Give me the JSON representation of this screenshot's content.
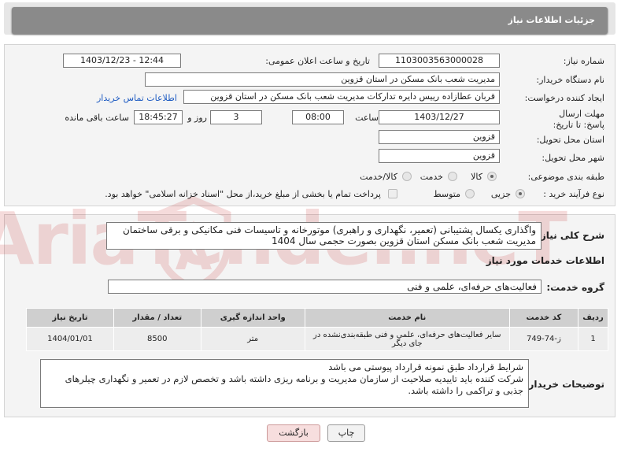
{
  "header": {
    "title": "جزئیات اطلاعات نیاز"
  },
  "form": {
    "need_number_label": "شماره نیاز:",
    "need_number": "1103003563000028",
    "announce_label": "تاریخ و ساعت اعلان عمومی:",
    "announce_value": "1403/12/23 - 12:44",
    "buyer_label": "نام دستگاه خریدار:",
    "buyer_value": "مدیریت شعب بانک مسکن در استان قزوین",
    "creator_label": "ایجاد کننده درخواست:",
    "creator_value": "قربان عطازاده رییس دایره تدارکات مدیریت شعب بانک مسکن در استان قزوین",
    "contact_link": "اطلاعات تماس خریدار",
    "deadline_label": "مهلت ارسال پاسخ: تا تاریخ:",
    "deadline_date": "1403/12/27",
    "time_label": "ساعت",
    "deadline_time": "08:00",
    "days_value": "3",
    "days_label": "روز و",
    "remaining_time": "18:45:27",
    "remaining_label": "ساعت باقی مانده",
    "province_label": "استان محل تحویل:",
    "province_value": "قزوین",
    "city_label": "شهر محل تحویل:",
    "city_value": "قزوین",
    "category_label": "طبقه بندی موضوعی:",
    "category_options": [
      "کالا",
      "خدمت",
      "کالا/خدمت"
    ],
    "process_label": "نوع فرآیند خرید :",
    "process_options": [
      "جزیی",
      "متوسط"
    ],
    "payment_note": "پرداخت تمام یا بخشی از مبلغ خرید،از محل \"اسناد خزانه اسلامی\" خواهد بود."
  },
  "summary": {
    "label": "شرح کلی نیاز:",
    "text": "واگذاری یکسال پشتیبانی (تعمیر، نگهداری و راهبری) موتورخانه و تاسیسات فنی مکانیکی و برقی ساختمان مدیریت شعب بانک مسکن استان قزوین بصورت حجمی سال 1404"
  },
  "services": {
    "title": "اطلاعات خدمات مورد نیاز",
    "group_label": "گروه خدمت:",
    "group_value": "فعالیت‌های حرفه‌ای، علمی و فنی",
    "columns": [
      "ردیف",
      "کد خدمت",
      "نام خدمت",
      "واحد اندازه گیری",
      "تعداد / مقدار",
      "تاریخ نیاز"
    ],
    "rows": [
      [
        "1",
        "ز-74-749",
        "سایر فعالیت‌های حرفه‌ای، علمی و فنی طبقه‌بندی‌نشده در جای دیگر",
        "متر",
        "8500",
        "1404/01/01"
      ]
    ]
  },
  "buyer_notes": {
    "label": "توضیحات خریدار:",
    "text": "شرایط قرارداد طبق نمونه قرارداد پیوستی می باشد\nشرکت کننده باید تاییدیه صلاحیت از سازمان مدیریت و برنامه ریزی داشته باشد و تخصص لازم در تعمیر و نگهداری چیلرهای جذبی و تراکمی را داشته باشد."
  },
  "buttons": {
    "print": "چاپ",
    "back": "بازگشت"
  },
  "watermark": {
    "text": "AriaTender.neT"
  },
  "colors": {
    "header_bg": "#8a8a8a",
    "link": "#1e5bc2",
    "back_button_bg": "#f7dede",
    "watermark": "#c62828"
  }
}
